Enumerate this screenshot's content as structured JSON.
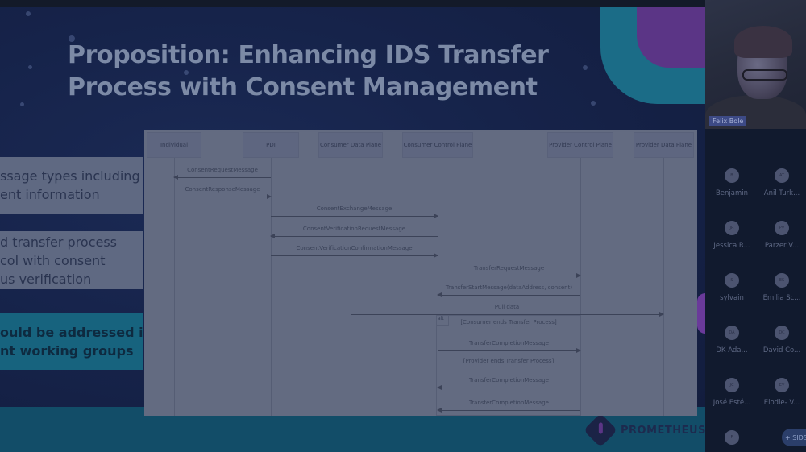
{
  "slide": {
    "title_line1": "Proposition: Enhancing IDS Transfer",
    "title_line2": "Process with Consent Management",
    "bullets": [
      {
        "lines": [
          "ssage types including",
          "ent information"
        ]
      },
      {
        "lines": [
          "d transfer process",
          "col with consent",
          "us verification"
        ]
      },
      {
        "lines": [
          "ould be addressed in",
          "nt working groups"
        ]
      }
    ],
    "logo_text": "PROMETHEUS",
    "colors": {
      "background": "#16234a",
      "accent_teal": "#1b6c87",
      "accent_purple": "#5b3586",
      "footer": "#124d68"
    }
  },
  "diagram": {
    "participants": [
      "Individual",
      "PDI",
      "Consumer Data Plane",
      "Consumer Control Plane",
      "Provider Control Plane",
      "Provider Data Plane"
    ],
    "messages": [
      {
        "label": "ConsentRequestMessage",
        "from": 1,
        "to": 0
      },
      {
        "label": "ConsentResponseMessage",
        "from": 0,
        "to": 1
      },
      {
        "label": "ConsentExchangeMessage",
        "from": 1,
        "to": 3
      },
      {
        "label": "ConsentVerificationRequestMessage",
        "from": 3,
        "to": 1
      },
      {
        "label": "ConsentVerificationConfirmationMessage",
        "from": 1,
        "to": 3
      },
      {
        "label": "TransferRequestMessage",
        "from": 3,
        "to": 4
      },
      {
        "label": "TransferStartMessage(dataAddress, consent)",
        "from": 4,
        "to": 3
      },
      {
        "label": "Pull data",
        "from": 2,
        "to": 5
      },
      {
        "label": "TransferCompletionMessage",
        "from": 3,
        "to": 4
      },
      {
        "label": "TransferCompletionMessage",
        "from": 4,
        "to": 3
      },
      {
        "label": "TransferCompletionMessage",
        "from": 4,
        "to": 3
      }
    ],
    "alt_fragment": {
      "tag": "alt",
      "conditions": [
        "[Consumer ends Transfer Process]",
        "[Provider ends Transfer Process]"
      ]
    }
  },
  "meeting": {
    "active_speaker": "Felix Bole",
    "attendees": [
      {
        "initials": "B",
        "name": "Benjamin"
      },
      {
        "initials": "AT",
        "name": "Anil Turk..."
      },
      {
        "initials": "JR",
        "name": "Jessica R..."
      },
      {
        "initials": "PV",
        "name": "Parzer V..."
      },
      {
        "initials": "S",
        "name": "sylvain"
      },
      {
        "initials": "ES",
        "name": "Emilia Sc..."
      },
      {
        "initials": "DA",
        "name": "DK Ada..."
      },
      {
        "initials": "DC",
        "name": "David Co..."
      },
      {
        "initials": "JC",
        "name": "José Esté..."
      },
      {
        "initials": "EV",
        "name": "Elodie- V..."
      },
      {
        "initials": "F",
        "name": ""
      }
    ],
    "more_label": "+ SIDSA"
  }
}
